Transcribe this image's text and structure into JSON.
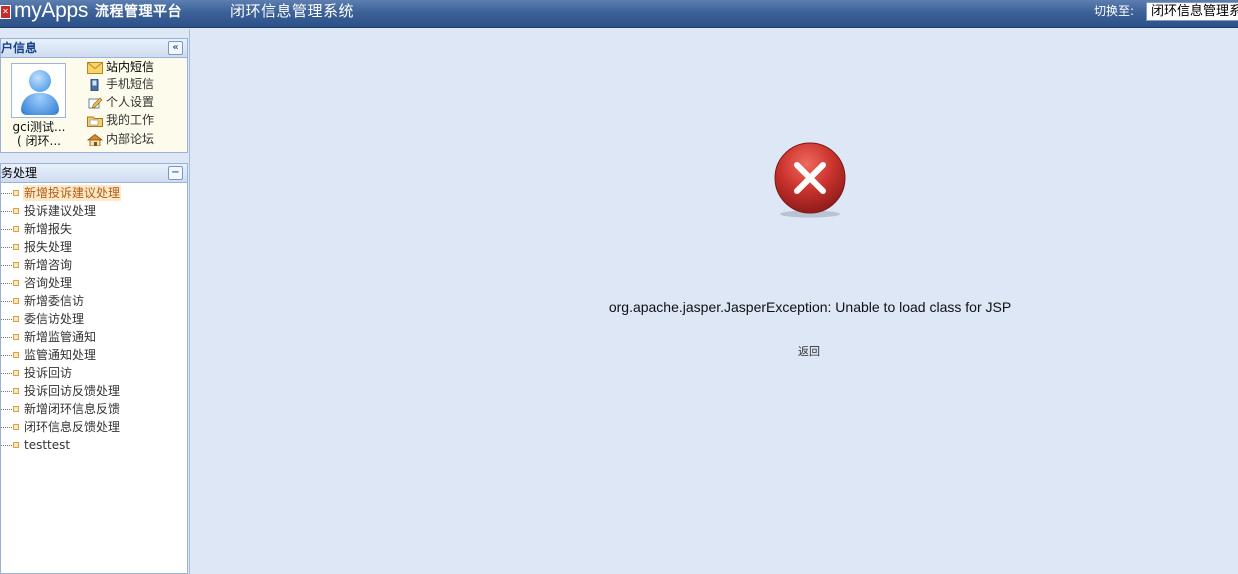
{
  "header": {
    "logo_text": "myApps",
    "logo_subtitle": "流程管理平台",
    "system_title": "闭环信息管理系统",
    "switch_label": "切换至:",
    "switch_selected": "闭环信息管理系统"
  },
  "user_panel": {
    "title": "用户信息",
    "user_name": "gci测试...",
    "user_group": "( 闭环...",
    "menu": [
      {
        "label": "站内短信",
        "icon": "mail-icon"
      },
      {
        "label": "手机短信",
        "icon": "mobile-phone-icon"
      },
      {
        "label": "个人设置",
        "icon": "edit-settings-icon"
      },
      {
        "label": "我的工作",
        "icon": "folder-work-icon"
      },
      {
        "label": "内部论坛",
        "icon": "home-forum-icon"
      }
    ]
  },
  "business_panel": {
    "title": "业务处理",
    "items": [
      {
        "label": "新增投诉建议处理"
      },
      {
        "label": "投诉建议处理"
      },
      {
        "label": "新增报失"
      },
      {
        "label": "报失处理"
      },
      {
        "label": "新增咨询"
      },
      {
        "label": "咨询处理"
      },
      {
        "label": "新增委信访"
      },
      {
        "label": "委信访处理"
      },
      {
        "label": "新增监管通知"
      },
      {
        "label": "监管通知处理"
      },
      {
        "label": "投诉回访"
      },
      {
        "label": "投诉回访反馈处理"
      },
      {
        "label": "新增闭环信息反馈"
      },
      {
        "label": "闭环信息反馈处理"
      },
      {
        "label": "testtest"
      }
    ]
  },
  "content": {
    "error_message": "org.apache.jasper.JasperException: Unable to load class for JSP",
    "back_label": "返回"
  },
  "colors": {
    "header_blue": "#3c6298",
    "content_bg": "#dde7f6",
    "error_red": "#c62a2a"
  }
}
